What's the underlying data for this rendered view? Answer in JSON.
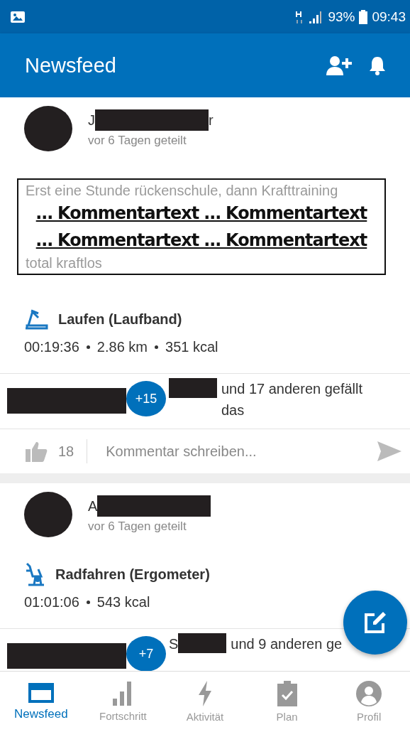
{
  "status_bar": {
    "battery": "93%",
    "time": "09:43"
  },
  "app_bar": {
    "title": "Newsfeed"
  },
  "posts": [
    {
      "author_start": "J",
      "author_end": "r",
      "time": "vor 6 Tagen geteilt",
      "comment_lines": [
        {
          "kind": "faint",
          "text": "Erst eine Stunde rückenschule, dann Krafttraining"
        },
        {
          "kind": "overlay",
          "text": "… Kommentartext … Kommentartext"
        },
        {
          "kind": "overlay",
          "text": "… Kommentartext … Kommentartext"
        },
        {
          "kind": "faint",
          "text": "total kraftlos"
        }
      ],
      "activity": {
        "kind": "treadmill",
        "name": "Laufen (Laufband)"
      },
      "stats": [
        "00:19:36",
        "2.86 km",
        "351 kcal"
      ],
      "likes": {
        "more": "+15",
        "text": "und 17 anderen gefällt das"
      },
      "like_count": "18",
      "comment_placeholder": "Kommentar schreiben..."
    },
    {
      "author_start": "A",
      "time": "vor 6 Tagen geteilt",
      "activity": {
        "kind": "bike",
        "name": "Radfahren (Ergometer)"
      },
      "stats": [
        "01:01:06",
        "543 kcal"
      ],
      "likes": {
        "more": "+7",
        "liker_start": "S",
        "text": "und 9 anderen ge"
      }
    }
  ],
  "nav": [
    {
      "kind": "feed",
      "label": "Newsfeed",
      "selected": true
    },
    {
      "kind": "chart",
      "label": "Fortschritt",
      "selected": false
    },
    {
      "kind": "bolt",
      "label": "Aktivität",
      "selected": false
    },
    {
      "kind": "plan",
      "label": "Plan",
      "selected": false
    },
    {
      "kind": "profile",
      "label": "Profil",
      "selected": false
    }
  ]
}
